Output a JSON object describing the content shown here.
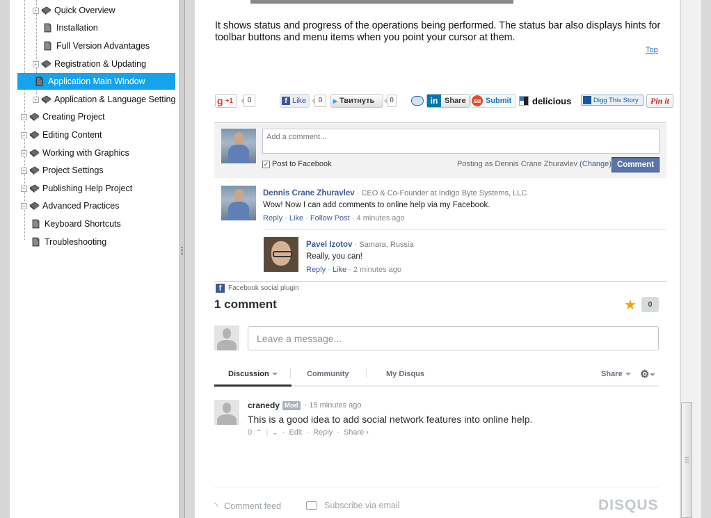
{
  "tree": {
    "items": [
      {
        "label": "Quick Overview",
        "kind": "book"
      },
      {
        "label": "Installation",
        "kind": "page"
      },
      {
        "label": "Full Version Advantages",
        "kind": "page"
      },
      {
        "label": "Registration & Updating",
        "kind": "book"
      },
      {
        "label": "Application Main Window",
        "kind": "page",
        "selected": true
      },
      {
        "label": "Application & Language Setting",
        "kind": "book"
      },
      {
        "label": "Creating Project",
        "kind": "book"
      },
      {
        "label": "Editing Content",
        "kind": "book"
      },
      {
        "label": "Working with Graphics",
        "kind": "book"
      },
      {
        "label": "Project Settings",
        "kind": "book"
      },
      {
        "label": "Publishing Help Project",
        "kind": "book"
      },
      {
        "label": "Advanced Practices",
        "kind": "book"
      },
      {
        "label": "Keyboard Shortcuts",
        "kind": "page"
      },
      {
        "label": "Troubleshooting",
        "kind": "page"
      }
    ]
  },
  "article": {
    "paragraph": "It shows status and progress of the operations being performed. The status bar also displays hints for toolbar buttons and menu items when you point your cursor at them.",
    "top_link": "Top"
  },
  "share": {
    "gplus_label": "+1",
    "gplus_count": "0",
    "fb_like_label": "Like",
    "fb_like_count": "0",
    "tweet_label": "Твитнуть",
    "tweet_count": "0",
    "linkedin_label": "Share",
    "stumble_label": "Submit",
    "delicious_label": "delicious",
    "digg_label": "Digg This Story",
    "pinit_label": "Pin it"
  },
  "facebook": {
    "input_placeholder": "Add a comment...",
    "post_to_label": "Post to Facebook",
    "posting_as": "Posting as Dennis Crane Zhuravlev",
    "change_label": "(Change)",
    "comment_button": "Comment",
    "comments": [
      {
        "name": "Dennis Crane Zhuravlev",
        "meta": " · CEO & Co-Founder at Indigo Byte Systems, LLC",
        "text": "Wow! Now I can add comments to online help via my Facebook.",
        "reply": "Reply",
        "like": "Like",
        "follow": "Follow Post",
        "time": "4 minutes ago"
      },
      {
        "name": "Pavel Izotov",
        "meta": " · Samara, Russia",
        "text": "Really, you can!",
        "reply": "Reply",
        "like": "Like",
        "time": "2 minutes ago"
      }
    ],
    "plugin_label": "Facebook social plugin"
  },
  "disqus": {
    "count_label": "1 comment",
    "votes": "0",
    "input_placeholder": "Leave a message...",
    "tabs": [
      "Discussion",
      "Community",
      "My Disqus"
    ],
    "share_label": "Share",
    "comment": {
      "author": "cranedy",
      "badge": "Mod",
      "time": "15 minutes ago",
      "text": "This is a good idea to add social network features into online help.",
      "votes": "0",
      "edit": "Edit",
      "reply": "Reply",
      "share": "Share ›"
    },
    "feed_label": "Comment feed",
    "subscribe_label": "Subscribe via email",
    "logo": "DISQUS"
  },
  "colors": {
    "selection": "#16a3ec",
    "facebook_blue": "#3b5998",
    "disqus_star": "#f0a20a"
  }
}
